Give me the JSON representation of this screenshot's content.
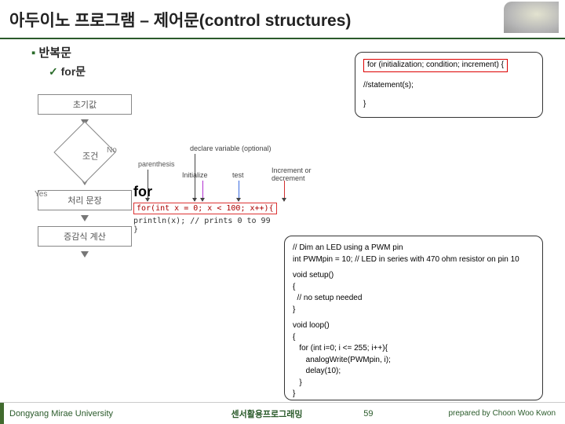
{
  "header": {
    "title": "아두이노 프로그램 – 제어문(control structures)"
  },
  "bullets": {
    "b1": "반복문",
    "b2": "for문"
  },
  "syntax": {
    "line1": "for (initialization; condition; increment) {",
    "line2": "//statement(s);",
    "line3": "}"
  },
  "illus": {
    "parenthesis": "parenthesis",
    "for": "for",
    "declare": "declare variable (optional)",
    "init": "Initialize",
    "test": "test",
    "incr": "Increment or decrement",
    "code": "for(int x = 0; x < 100; x++){",
    "p1": "    println(x);  // prints 0 to 99",
    "p2": "}"
  },
  "flow": {
    "init": "초기값",
    "cond": "조건",
    "yes": "Yes",
    "no": "No",
    "proc": "처리 문장",
    "step": "증감식 계산"
  },
  "example": {
    "c1": "// Dim an LED using a PWM pin",
    "c2": "int PWMpin = 10; // LED in series with 470 ohm resistor on pin 10",
    "c3": "void setup()",
    "c4": "{",
    "c5": "  // no setup needed",
    "c6": "}",
    "c7": "void loop()",
    "c8": "{",
    "c9": "   for (int i=0; i <= 255; i++){",
    "c10": "      analogWrite(PWMpin, i);",
    "c11": "      delay(10);",
    "c12": "   }",
    "c13": "}"
  },
  "footer": {
    "uni": "Dongyang Mirae University",
    "course": "센서활용프로그래밍",
    "page": "59",
    "author": "prepared by Choon Woo Kwon"
  }
}
